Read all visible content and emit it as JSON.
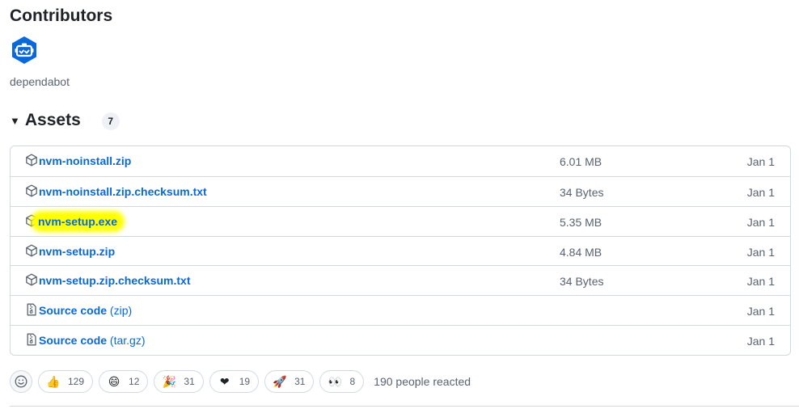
{
  "contributors": {
    "title": "Contributors",
    "users": [
      {
        "name": "dependabot",
        "avatar_icon": "dependabot-icon",
        "avatar_color": "#0969da"
      }
    ]
  },
  "assets": {
    "title": "Assets",
    "count": "7",
    "items": [
      {
        "name": "nvm-noinstall.zip",
        "suffix": "",
        "size": "6.01 MB",
        "date": "Jan 1",
        "icon": "package-icon"
      },
      {
        "name": "nvm-noinstall.zip.checksum.txt",
        "suffix": "",
        "size": "34 Bytes",
        "date": "Jan 1",
        "icon": "package-icon"
      },
      {
        "name": "nvm-setup.exe",
        "suffix": "",
        "size": "5.35 MB",
        "date": "Jan 1",
        "icon": "package-icon",
        "highlighted": true
      },
      {
        "name": "nvm-setup.zip",
        "suffix": "",
        "size": "4.84 MB",
        "date": "Jan 1",
        "icon": "package-icon"
      },
      {
        "name": "nvm-setup.zip.checksum.txt",
        "suffix": "",
        "size": "34 Bytes",
        "date": "Jan 1",
        "icon": "package-icon"
      },
      {
        "name": "Source code",
        "suffix": " (zip)",
        "size": "",
        "date": "Jan 1",
        "icon": "file-zip-icon"
      },
      {
        "name": "Source code",
        "suffix": " (tar.gz)",
        "size": "",
        "date": "Jan 1",
        "icon": "file-zip-icon"
      }
    ]
  },
  "reactions": {
    "items": [
      {
        "emoji": "👍",
        "icon": "thumbs-up-icon",
        "count": "129"
      },
      {
        "emoji": "😄",
        "icon": "laugh-icon",
        "count": "12"
      },
      {
        "emoji": "🎉",
        "icon": "hooray-icon",
        "count": "31"
      },
      {
        "emoji": "❤",
        "icon": "heart-icon",
        "count": "19"
      },
      {
        "emoji": "🚀",
        "icon": "rocket-icon",
        "count": "31"
      },
      {
        "emoji": "👀",
        "icon": "eyes-icon",
        "count": "8"
      }
    ],
    "summary": "190 people reacted"
  },
  "colors": {
    "link": "#0969da",
    "muted": "#59636e",
    "highlight": "#ffff00",
    "border": "#d1d9e0"
  }
}
